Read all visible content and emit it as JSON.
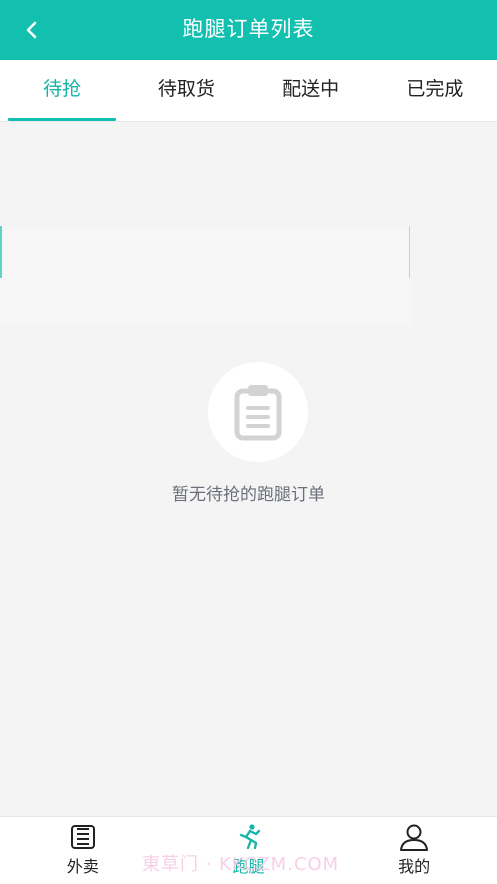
{
  "header": {
    "title": "跑腿订单列表",
    "back_icon": "chevron-left-icon"
  },
  "tabs": [
    {
      "label": "待抢",
      "active": true
    },
    {
      "label": "待取货",
      "active": false
    },
    {
      "label": "配送中",
      "active": false
    },
    {
      "label": "已完成",
      "active": false
    }
  ],
  "empty_state": {
    "icon": "clipboard-icon",
    "message": "暂无待抢的跑腿订单"
  },
  "bottom_nav": [
    {
      "label": "外卖",
      "icon": "list-document-icon",
      "active": false
    },
    {
      "label": "跑腿",
      "icon": "runner-icon",
      "active": true
    },
    {
      "label": "我的",
      "icon": "person-icon",
      "active": false
    }
  ],
  "watermark": "東草门 · KKCZM.COM",
  "colors": {
    "accent": "#13c0b0",
    "text_muted": "#6b6f7a",
    "background": "#f4f4f4"
  }
}
